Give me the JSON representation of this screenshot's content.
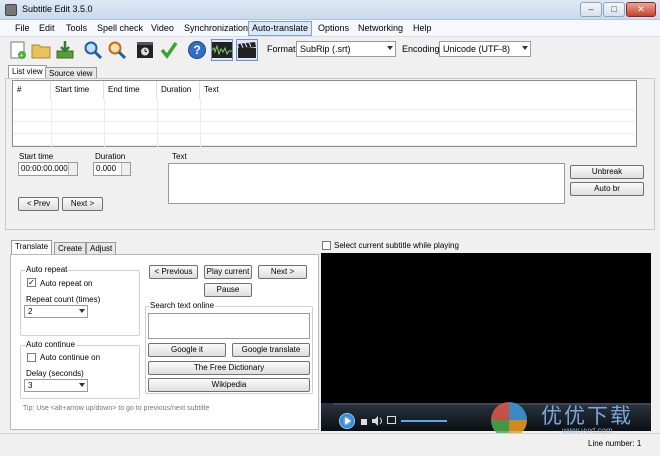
{
  "window": {
    "title": "Subtitle Edit 3.5.0"
  },
  "menu": [
    "File",
    "Edit",
    "Tools",
    "Spell check",
    "Video",
    "Synchronization",
    "Auto-translate",
    "Options",
    "Networking",
    "Help"
  ],
  "toolbar": {
    "format_label": "Format",
    "format_value": "SubRip (.srt)",
    "encoding_label": "Encoding",
    "encoding_value": "Unicode (UTF-8)"
  },
  "view_tabs": [
    "List view",
    "Source view"
  ],
  "grid": {
    "columns": [
      "#",
      "Start time",
      "End time",
      "Duration",
      "Text"
    ]
  },
  "editor": {
    "start_time_label": "Start time",
    "start_time_value": "00:00:00.000",
    "duration_label": "Duration",
    "duration_value": "0.000",
    "text_label": "Text",
    "prev_button": "< Prev",
    "next_button": "Next >",
    "unbreak_button": "Unbreak",
    "auto_br_button": "Auto br"
  },
  "bottom_tabs": [
    "Translate",
    "Create",
    "Adjust"
  ],
  "translate": {
    "auto_repeat_title": "Auto repeat",
    "auto_repeat_on": "Auto repeat on",
    "repeat_count_label": "Repeat count (times)",
    "repeat_count_value": "2",
    "auto_continue_title": "Auto continue",
    "auto_continue_on": "Auto continue on",
    "delay_label": "Delay (seconds)",
    "delay_value": "3",
    "previous_button": "< Previous",
    "play_current_button": "Play current",
    "next_button": "Next >",
    "pause_button": "Pause",
    "search_title": "Search text online",
    "google_it_button": "Google it",
    "google_translate_button": "Google translate",
    "free_dictionary_button": "The Free Dictionary",
    "wikipedia_button": "Wikipedia",
    "tip": "Tip: Use <alt+arrow up/down> to go to previous/next subtitle"
  },
  "video": {
    "select_current_label": "Select current subtitle while playing"
  },
  "watermark": {
    "text": "优优下载",
    "url": "www.yyxt.com"
  },
  "status": {
    "line_number": "Line number: 1"
  }
}
